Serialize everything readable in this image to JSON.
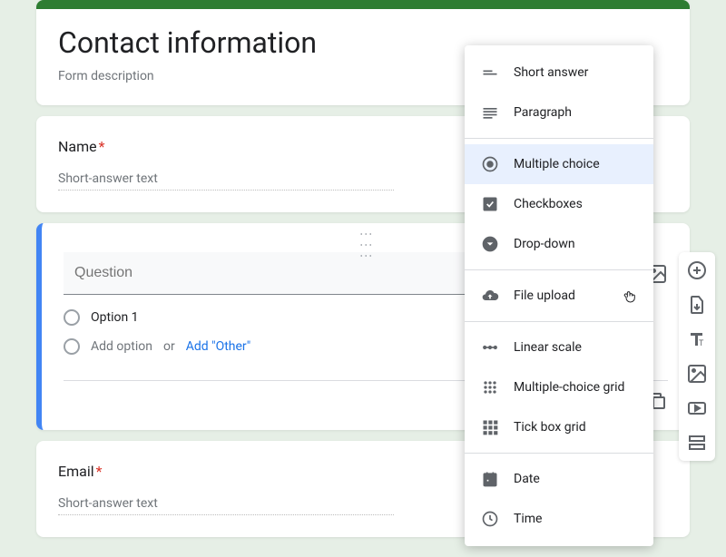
{
  "form": {
    "title": "Contact information",
    "description": "Form description"
  },
  "questions": {
    "name": {
      "label": "Name",
      "placeholder": "Short-answer text"
    },
    "active": {
      "question_placeholder": "Question",
      "option1": "Option 1",
      "add_option": "Add option",
      "or": "or",
      "add_other": "Add \"Other\""
    },
    "email": {
      "label": "Email",
      "placeholder": "Short-answer text"
    }
  },
  "dropdown": {
    "short_answer": "Short answer",
    "paragraph": "Paragraph",
    "multiple_choice": "Multiple choice",
    "checkboxes": "Checkboxes",
    "drop_down": "Drop-down",
    "file_upload": "File upload",
    "linear_scale": "Linear scale",
    "multiple_choice_grid": "Multiple-choice grid",
    "tick_box_grid": "Tick box grid",
    "date": "Date",
    "time": "Time"
  },
  "required_marker": "*"
}
